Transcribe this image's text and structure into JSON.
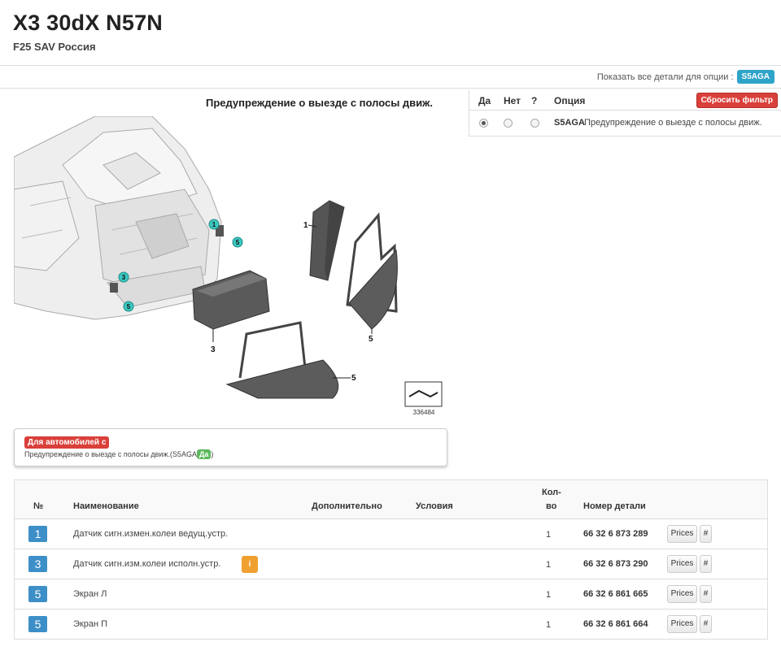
{
  "header": {
    "title": "X3 30dX N57N",
    "subtitle": "F25 SAV Россия"
  },
  "option_bar": {
    "label": "Показать все детали для опции :",
    "option_code": "S5AGA"
  },
  "diagram": {
    "title": "Предупреждение о выезде с полосы движ.",
    "callouts": [
      "1",
      "3",
      "5",
      "5",
      "1",
      "3",
      "5"
    ],
    "image_number": "336484"
  },
  "filter": {
    "columns": {
      "yes": "Да",
      "no": "Нет",
      "unknown": "?",
      "option": "Опция"
    },
    "reset_label": "Сбросить фильтр",
    "row": {
      "code": "S5AGA",
      "description": "Предупреждение о выезде с полосы движ.",
      "selected": "yes"
    }
  },
  "note": {
    "label": "Для автомобилей с",
    "text_prefix": "Предупреждение о выезде с полосы движ.(S5AGA",
    "value": "Да",
    "text_suffix": ")"
  },
  "parts_table": {
    "headers": {
      "number": "№",
      "name": "Наименование",
      "extra": "Дополнительно",
      "conditions": "Условия",
      "qty_line1": "Кол-",
      "qty_line2": "во",
      "part_number": "Номер детали"
    },
    "prices_label": "Prices",
    "hash_label": "#",
    "info_icon": "i",
    "rows": [
      {
        "num": "1",
        "name": "Датчик сигн.измен.колеи ведущ.устр.",
        "qty": "1",
        "part": "66 32 6 873 289",
        "info": false
      },
      {
        "num": "3",
        "name": "Датчик сигн.изм.колеи исполн.устр.",
        "qty": "1",
        "part": "66 32 6 873 290",
        "info": true
      },
      {
        "num": "5",
        "name": "Экран Л",
        "qty": "1",
        "part": "66 32 6 861 665",
        "info": false
      },
      {
        "num": "5",
        "name": "Экран П",
        "qty": "1",
        "part": "66 32 6 861 664",
        "info": false
      }
    ]
  },
  "colors": {
    "badge_blue": "#3d8fc7",
    "option_badge": "#2fa4c9",
    "reset_red": "#d9403a",
    "yes_green": "#5cb85c",
    "info_orange": "#f0a030",
    "callout_teal": "#3cc7c0"
  }
}
